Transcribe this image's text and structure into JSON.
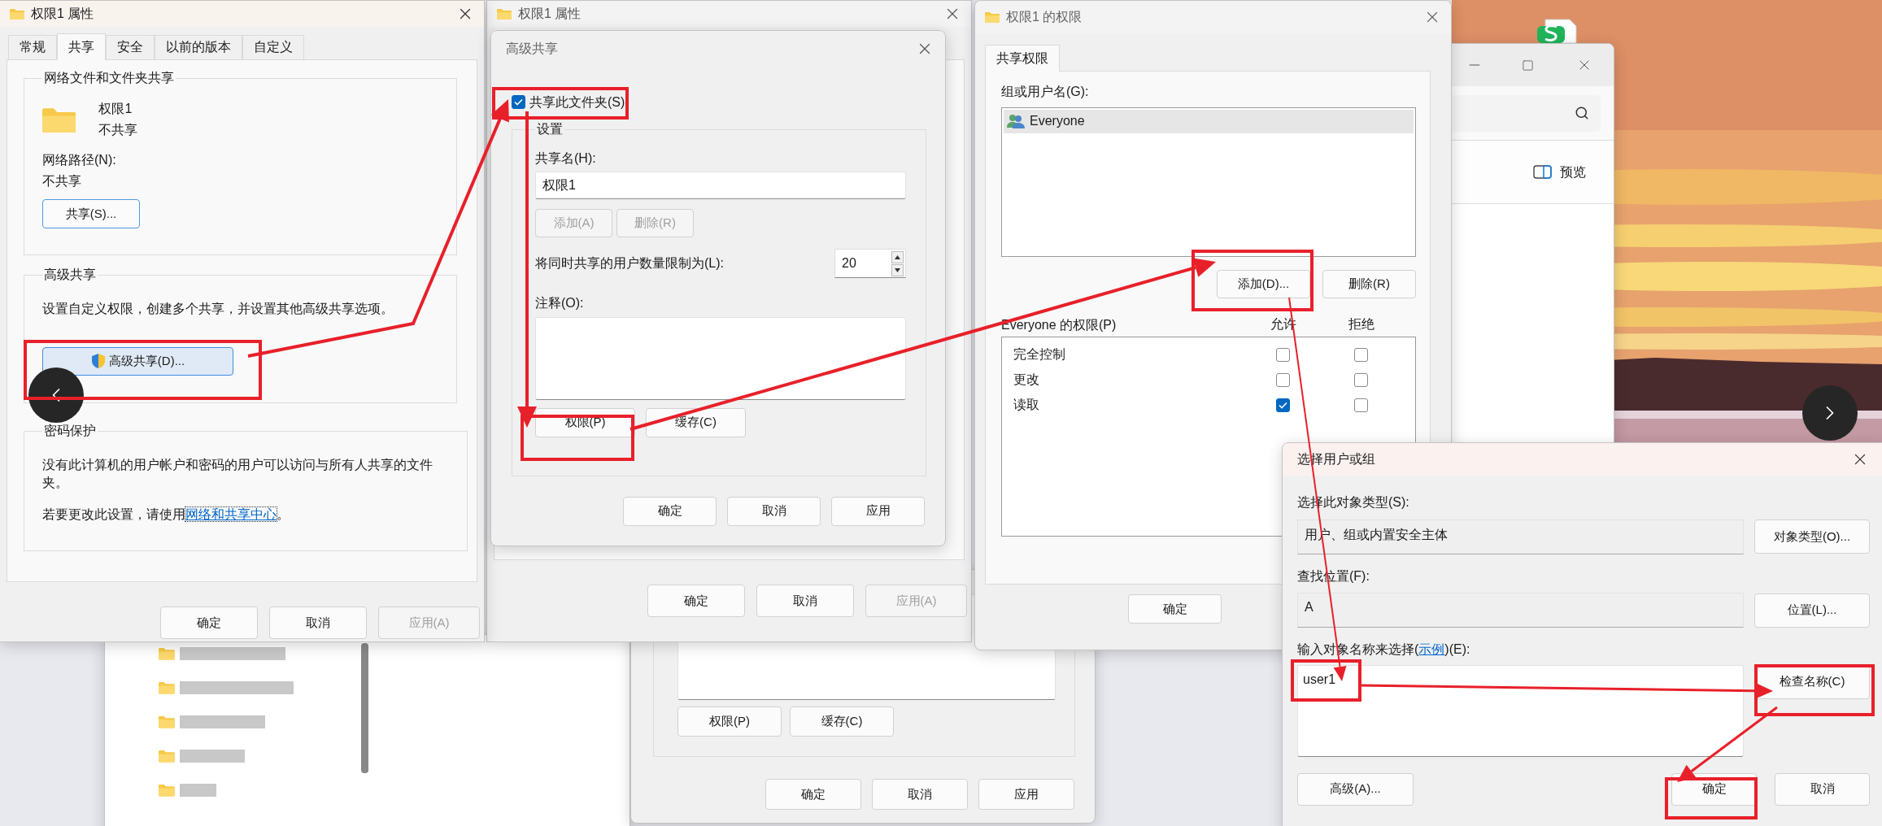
{
  "properties_window": {
    "title": "权限1 属性",
    "tabs": [
      {
        "label": "常规",
        "selected": false
      },
      {
        "label": "共享",
        "selected": true
      },
      {
        "label": "安全",
        "selected": false
      },
      {
        "label": "以前的版本",
        "selected": false
      },
      {
        "label": "自定义",
        "selected": false
      }
    ],
    "network_sharing": {
      "title": "网络文件和文件夹共享",
      "folder_name": "权限1",
      "folder_status": "不共享",
      "path_label": "网络路径(N):",
      "path_value": "不共享",
      "share_button": "共享(S)..."
    },
    "advanced_sharing": {
      "title": "高级共享",
      "description": "设置自定义权限，创建多个共享，并设置其他高级共享选项。",
      "button": "高级共享(D)..."
    },
    "password_protection": {
      "title": "密码保护",
      "description": "没有此计算机的用户帐户和密码的用户可以访问与所有人共享的文件夹。",
      "hint": "若要更改此设置，请使用",
      "link": "网络和共享中心",
      "hint_end": "。"
    },
    "buttons": [
      {
        "label": "确定",
        "disabled": false
      },
      {
        "label": "取消",
        "disabled": false
      },
      {
        "label": "应用(A)",
        "disabled": true
      }
    ]
  },
  "back_properties_window": {
    "title": "权限1 属性",
    "buttons": [
      {
        "label": "确定",
        "disabled": false
      },
      {
        "label": "取消",
        "disabled": false
      },
      {
        "label": "应用(A)",
        "disabled": true
      }
    ]
  },
  "advanced_sharing_dialog": {
    "title": "高级共享",
    "share_checkbox": {
      "label": "共享此文件夹(S)",
      "checked": true
    },
    "settings_title": "设置",
    "share_name_label": "共享名(H):",
    "share_name": "权限1",
    "share_name_buttons": [
      {
        "label": "添加(A)",
        "disabled": true
      },
      {
        "label": "删除(R)",
        "disabled": true
      }
    ],
    "user_limit_label": "将同时共享的用户数量限制为(L):",
    "user_limit": "20",
    "comment_label": "注释(O):",
    "buttons": [
      "权限(P)",
      "缓存(C)"
    ],
    "footer_buttons": [
      "确定",
      "取消",
      "应用"
    ]
  },
  "back_sharing_dialog": {
    "buttons": [
      "权限(P)",
      "缓存(C)"
    ],
    "footer_buttons": [
      "确定",
      "取消",
      "应用"
    ]
  },
  "permissions_window": {
    "title": "权限1 的权限",
    "tabs": [
      {
        "label": "共享权限",
        "selected": true
      }
    ],
    "users_label": "组或用户名(G):",
    "users": [
      {
        "name": "Everyone",
        "selected": true
      }
    ],
    "user_buttons": [
      "添加(D)...",
      "删除(R)"
    ],
    "permissions_label": "Everyone 的权限(P)",
    "allow_label": "允许",
    "deny_label": "拒绝",
    "permissions": [
      {
        "name": "完全控制",
        "allow": false,
        "deny": false
      },
      {
        "name": "更改",
        "allow": false,
        "deny": false
      },
      {
        "name": "读取",
        "allow": true,
        "deny": false
      }
    ],
    "buttons": [
      "确定"
    ]
  },
  "explorer_window": {
    "preview_label": "预览"
  },
  "select_user_dialog": {
    "title": "选择用户或组",
    "object_type_label": "选择此对象类型(S):",
    "object_type": "用户、组或内置安全主体",
    "object_type_button": "对象类型(O)...",
    "location_label": "查找位置(F):",
    "location": "A",
    "location_button": "位置(L)...",
    "names_label_before": "输入对象名称来选择(",
    "names_link": "示例",
    "names_label_after": ")(E):",
    "names_value": "user1",
    "check_button": "检查名称(C)",
    "advanced_button": "高级(A)...",
    "buttons": [
      "确定",
      "取消"
    ]
  }
}
